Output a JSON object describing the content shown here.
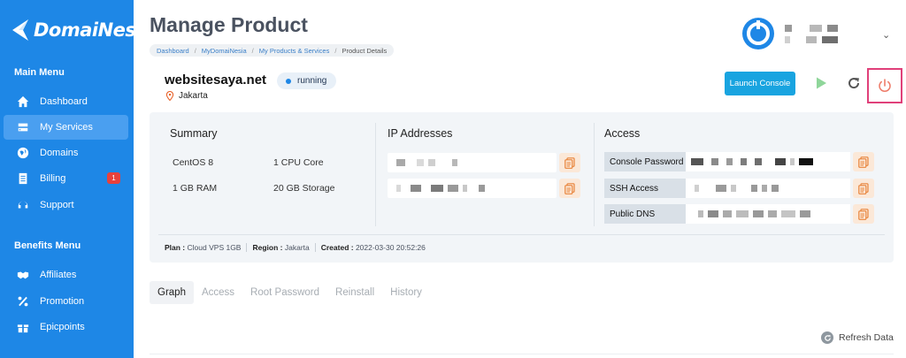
{
  "brand": {
    "name": "DomaiNesia"
  },
  "sidebar": {
    "main_heading": "Main Menu",
    "main_items": [
      {
        "label": "Dashboard",
        "icon": "home-icon"
      },
      {
        "label": "My Services",
        "icon": "server-icon",
        "active": true
      },
      {
        "label": "Domains",
        "icon": "globe-icon"
      },
      {
        "label": "Billing",
        "icon": "document-icon",
        "badge": "1"
      },
      {
        "label": "Support",
        "icon": "headset-icon"
      }
    ],
    "benefits_heading": "Benefits Menu",
    "benefit_items": [
      {
        "label": "Affiliates",
        "icon": "handshake-icon"
      },
      {
        "label": "Promotion",
        "icon": "percent-icon"
      },
      {
        "label": "Epicpoints",
        "icon": "gift-icon"
      }
    ]
  },
  "header": {
    "title": "Manage Product",
    "breadcrumb": [
      "Dashboard",
      "MyDomaiNesia",
      "My Products & Services",
      "Product Details"
    ]
  },
  "product": {
    "domain": "websitesaya.net",
    "location": "Jakarta",
    "status": "running",
    "launch_label": "Launch Console"
  },
  "summary": {
    "title": "Summary",
    "specs": [
      "CentOS 8",
      "1 CPU Core",
      "1 GB RAM",
      "20 GB Storage"
    ]
  },
  "ip": {
    "title": "IP Addresses"
  },
  "access": {
    "title": "Access",
    "labels": [
      "Console Password",
      "SSH Access",
      "Public DNS"
    ]
  },
  "meta": {
    "plan_label": "Plan :",
    "plan_value": "Cloud VPS 1GB",
    "region_label": "Region :",
    "region_value": "Jakarta",
    "created_label": "Created :",
    "created_value": "2022-03-30 20:52:26"
  },
  "tabs": [
    "Graph",
    "Access",
    "Root Password",
    "Reinstall",
    "History"
  ],
  "refresh_label": "Refresh Data",
  "colors": {
    "sidebar": "#1e87e6",
    "launch": "#19a4e0",
    "copy_accent": "#e8833a",
    "play": "#8fd69a",
    "power": "#e0407a"
  }
}
